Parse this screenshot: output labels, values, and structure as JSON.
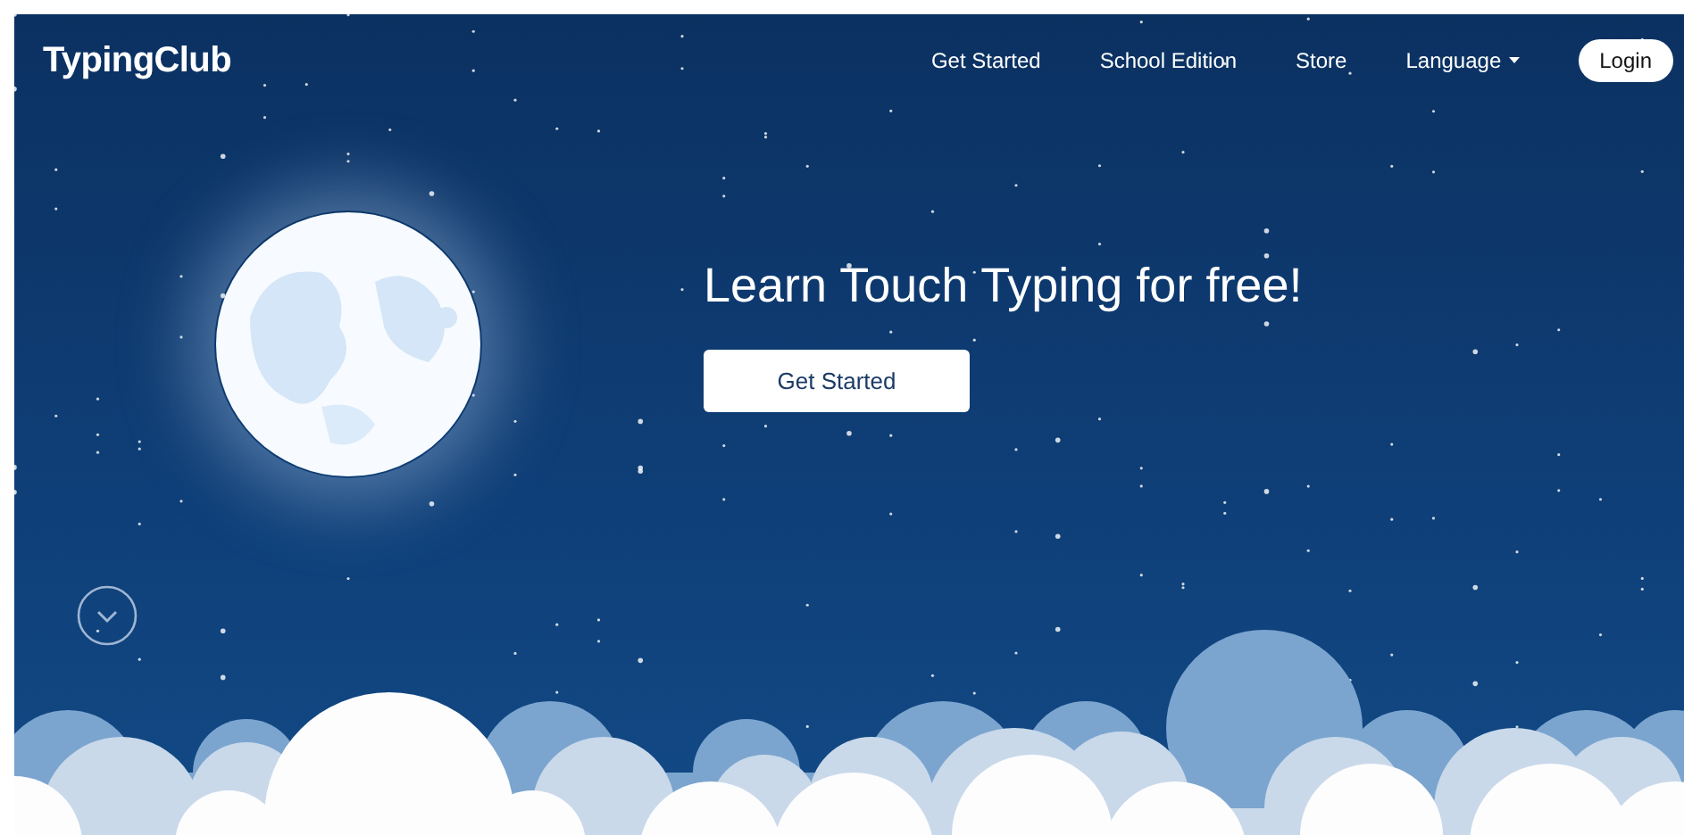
{
  "logo": "TypingClub",
  "nav": [
    {
      "label": "Get Started",
      "kind": "link"
    },
    {
      "label": "School Edition",
      "kind": "link"
    },
    {
      "label": "Store",
      "kind": "link"
    },
    {
      "label": "Language",
      "kind": "dropdown"
    },
    {
      "label": "Login",
      "kind": "button"
    }
  ],
  "hero": {
    "heading": "Learn Touch Typing for free!",
    "button": "Get Started"
  }
}
